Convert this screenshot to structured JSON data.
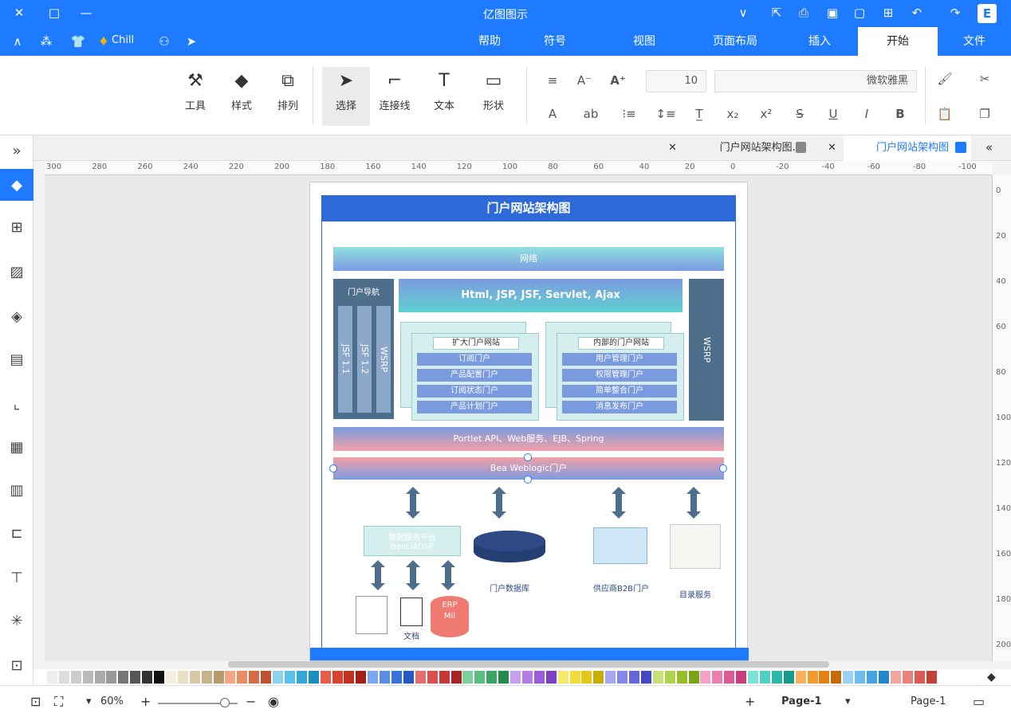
{
  "app": {
    "title": "亿图图示"
  },
  "titlebar": {
    "user": "Chill"
  },
  "menu": {
    "tabs": [
      "文件",
      "开始",
      "插入",
      "页面布局",
      "视图",
      "符号",
      "帮助"
    ],
    "active": "开始"
  },
  "ribbon": {
    "font_name": "微软雅黑",
    "font_size": "10",
    "tools": [
      {
        "label": "形状",
        "icon": "rectangle-icon"
      },
      {
        "label": "文本",
        "icon": "text-icon"
      },
      {
        "label": "连接线",
        "icon": "connector-icon"
      },
      {
        "label": "选择",
        "icon": "cursor-icon"
      },
      {
        "label": "排列",
        "icon": "arrange-icon"
      },
      {
        "label": "样式",
        "icon": "fill-icon"
      },
      {
        "label": "工具",
        "icon": "tools-icon"
      }
    ]
  },
  "doc_tabs": [
    {
      "label": "门户网站架构图"
    },
    {
      "label": "门户网站架构图..."
    }
  ],
  "ruler_h": [
    "-100",
    "-80",
    "-60",
    "-40",
    "-20",
    "0",
    "20",
    "40",
    "60",
    "80",
    "100",
    "120",
    "140",
    "160",
    "180",
    "200",
    "220",
    "240",
    "260",
    "280",
    "300"
  ],
  "ruler_v": [
    "0",
    "20",
    "40",
    "60",
    "80",
    "100",
    "120",
    "140",
    "160",
    "180",
    "200"
  ],
  "diagram": {
    "title": "门户网站架构图",
    "network": "网络",
    "web_layer": "Html, JSP, JSF, Servlet, Ajax",
    "portal_nav": "门户导航",
    "nav_cells": [
      "JSF 1.1",
      "JSF 1.2",
      "WSRP"
    ],
    "wsrp": "WSRP",
    "internal_panel": {
      "title": "内部的门户网站",
      "items": [
        "用户管理门户",
        "权限管理门户",
        "简单整合门户",
        "消息发布门户"
      ]
    },
    "external_panel": {
      "title": "扩大门户网站",
      "items": [
        "订阅门户",
        "产品配置门户",
        "订阅状态门户",
        "产品计划门户"
      ]
    },
    "services": "Portlet API、Web服务、EJB、Spring",
    "server": "Bea Weblogic门户",
    "bottom_nodes": {
      "data_platform": [
        "数据服务平台",
        "BeaLiADSP"
      ],
      "portal_db": "门户数据库",
      "supplier": "供应商B2B门户",
      "catalog": "目录服务",
      "doc": "文档",
      "erp": [
        "ERP",
        "Mil"
      ]
    }
  },
  "statusbar": {
    "page_nav": "Page-1",
    "page_tab": "Page-1",
    "zoom": "60%"
  },
  "colors": {
    "accent": "#1e7bff",
    "diagram_blue": "#2d6ad8",
    "slate": "#4e6f8c"
  }
}
